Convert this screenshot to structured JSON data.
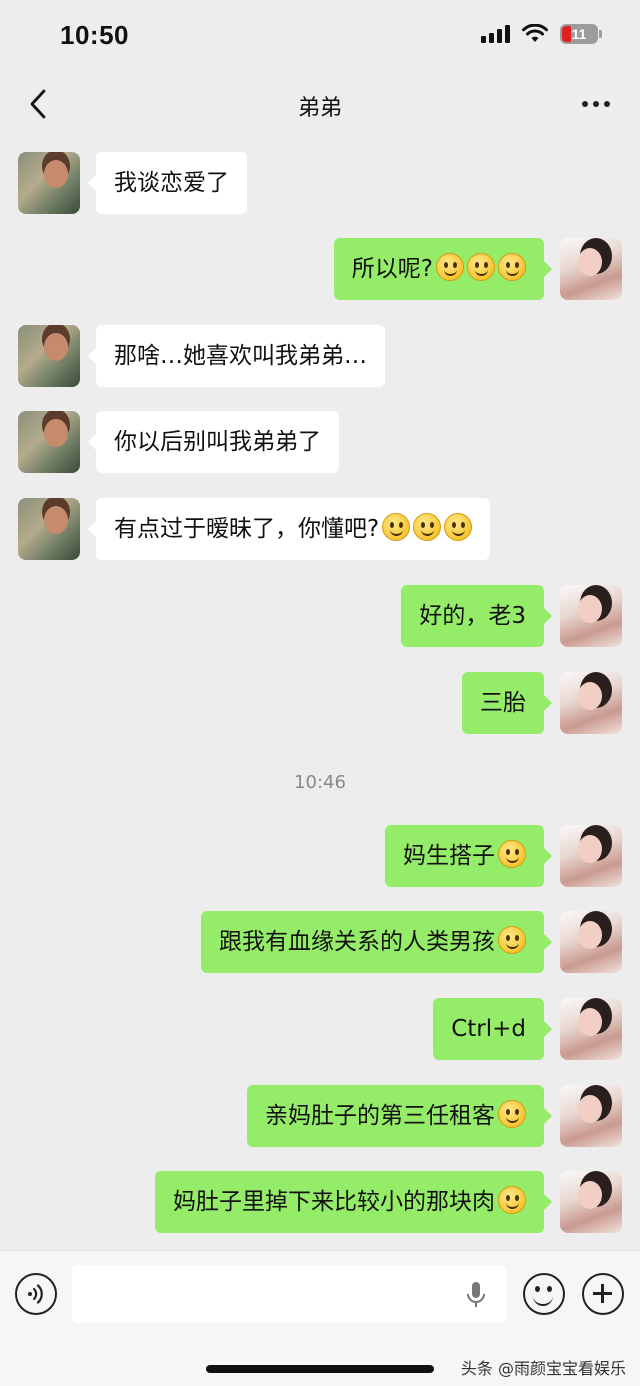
{
  "status_bar": {
    "time": "10:50",
    "battery_level": "11",
    "icons": [
      "signal-icon",
      "wifi-icon",
      "battery-icon"
    ]
  },
  "header": {
    "title": "弟弟",
    "back_icon": "chevron-left-icon",
    "more_icon": "more-dots-icon"
  },
  "messages": [
    {
      "side": "left",
      "text": "我谈恋爱了",
      "emoji_count": 0
    },
    {
      "side": "right",
      "text": "所以呢?",
      "emoji_count": 3
    },
    {
      "side": "left",
      "text": "那啥…她喜欢叫我弟弟…",
      "emoji_count": 0
    },
    {
      "side": "left",
      "text": "你以后别叫我弟弟了",
      "emoji_count": 0
    },
    {
      "side": "left",
      "text": "有点过于暧昧了，你懂吧?",
      "emoji_count": 3
    },
    {
      "side": "right",
      "text": "好的，老3",
      "emoji_count": 0
    },
    {
      "side": "right",
      "text": "三胎",
      "emoji_count": 0
    },
    {
      "side": "right",
      "text": "妈生搭子",
      "emoji_count": 1
    },
    {
      "side": "right",
      "text": "跟我有血缘关系的人类男孩",
      "emoji_count": 1
    },
    {
      "side": "right",
      "text": "Ctrl+d",
      "emoji_count": 0
    },
    {
      "side": "right",
      "text": "亲妈肚子的第三任租客",
      "emoji_count": 1
    },
    {
      "side": "right",
      "text": "妈肚子里掉下来比较小的那块肉",
      "emoji_count": 1
    }
  ],
  "timestamp": "10:46",
  "input_bar": {
    "text_value": "",
    "icons": [
      "voice-icon",
      "mic-icon",
      "emoji-icon",
      "plus-icon"
    ]
  },
  "watermark": "头条 @雨颜宝宝看娱乐",
  "colors": {
    "background": "#ededed",
    "own_bubble": "#95ec69",
    "other_bubble": "#ffffff"
  }
}
